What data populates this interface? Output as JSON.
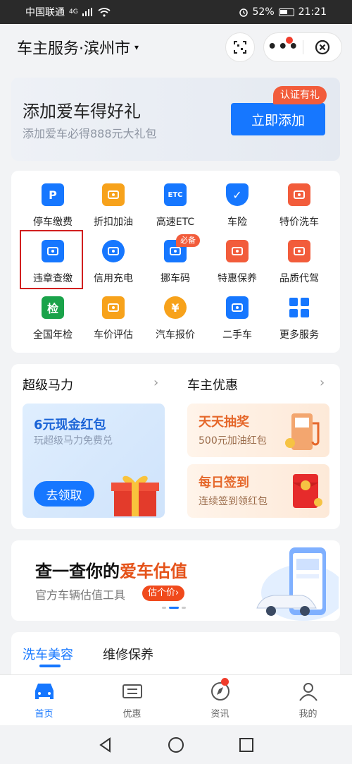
{
  "status_bar": {
    "carrier": "中国联通",
    "network": "4G",
    "battery": "52%",
    "time": "21:21"
  },
  "header": {
    "title": "车主服务·滨州市",
    "caret": "▾"
  },
  "banner": {
    "title": "添加爱车得好礼",
    "subtitle": "添加爱车必得888元大礼包",
    "button": "立即添加",
    "badge": "认证有礼"
  },
  "services": [
    {
      "label": "停车缴费",
      "icon": "parking-icon",
      "glyph": "P",
      "color": "#1677ff"
    },
    {
      "label": "折扣加油",
      "icon": "fuel-icon",
      "glyph": "",
      "color": "#f7a21b"
    },
    {
      "label": "高速ETC",
      "icon": "etc-icon",
      "glyph": "ETC",
      "color": "#1677ff"
    },
    {
      "label": "车险",
      "icon": "insurance-shield-icon",
      "glyph": "✓",
      "color": "#1677ff"
    },
    {
      "label": "特价洗车",
      "icon": "car-wash-icon",
      "glyph": "",
      "color": "#f25c3b"
    },
    {
      "label": "违章查缴",
      "icon": "traffic-camera-icon",
      "glyph": "",
      "color": "#1677ff"
    },
    {
      "label": "信用充电",
      "icon": "charging-icon",
      "glyph": "",
      "color": "#1677ff"
    },
    {
      "label": "挪车码",
      "icon": "move-car-icon",
      "glyph": "",
      "color": "#1677ff"
    },
    {
      "label": "特惠保养",
      "icon": "oil-bottle-icon",
      "glyph": "",
      "color": "#f25c3b"
    },
    {
      "label": "品质代驾",
      "icon": "driver-icon",
      "glyph": "",
      "color": "#f25c3b"
    },
    {
      "label": "全国年检",
      "icon": "inspection-icon",
      "glyph": "检",
      "color": "#1aa34a"
    },
    {
      "label": "车价评估",
      "icon": "calculator-icon",
      "glyph": "",
      "color": "#f7a21b"
    },
    {
      "label": "汽车报价",
      "icon": "price-yen-icon",
      "glyph": "¥",
      "color": "#f7a21b"
    },
    {
      "label": "二手车",
      "icon": "used-car-icon",
      "glyph": "",
      "color": "#1677ff"
    },
    {
      "label": "更多服务",
      "icon": "more-grid-icon",
      "glyph": "",
      "color": "#1677ff"
    }
  ],
  "service_tag": "必备",
  "promo": {
    "left_title": "超级马力",
    "right_title": "车主优惠",
    "chevron": "›",
    "left_card": {
      "title": "6元现金红包",
      "subtitle": "玩超级马力免费兑",
      "button": "去领取"
    },
    "right_cards": [
      {
        "title": "天天抽奖",
        "subtitle": "500元加油红包"
      },
      {
        "title": "每日签到",
        "subtitle": "连续签到领红包"
      }
    ]
  },
  "valuation": {
    "title_prefix": "查一查你的",
    "title_highlight": "爱车估值",
    "subtitle": "官方车辆估值工具",
    "pill": "估个价›"
  },
  "tabs": [
    "洗车美容",
    "维修保养"
  ],
  "bottom_nav": [
    {
      "label": "首页",
      "icon": "car-home-icon"
    },
    {
      "label": "优惠",
      "icon": "ticket-icon"
    },
    {
      "label": "资讯",
      "icon": "compass-icon"
    },
    {
      "label": "我的",
      "icon": "user-icon"
    }
  ],
  "colors": {
    "accent": "#1677ff",
    "badge": "#f25c3b",
    "highlight_box": "#d11f1f"
  }
}
